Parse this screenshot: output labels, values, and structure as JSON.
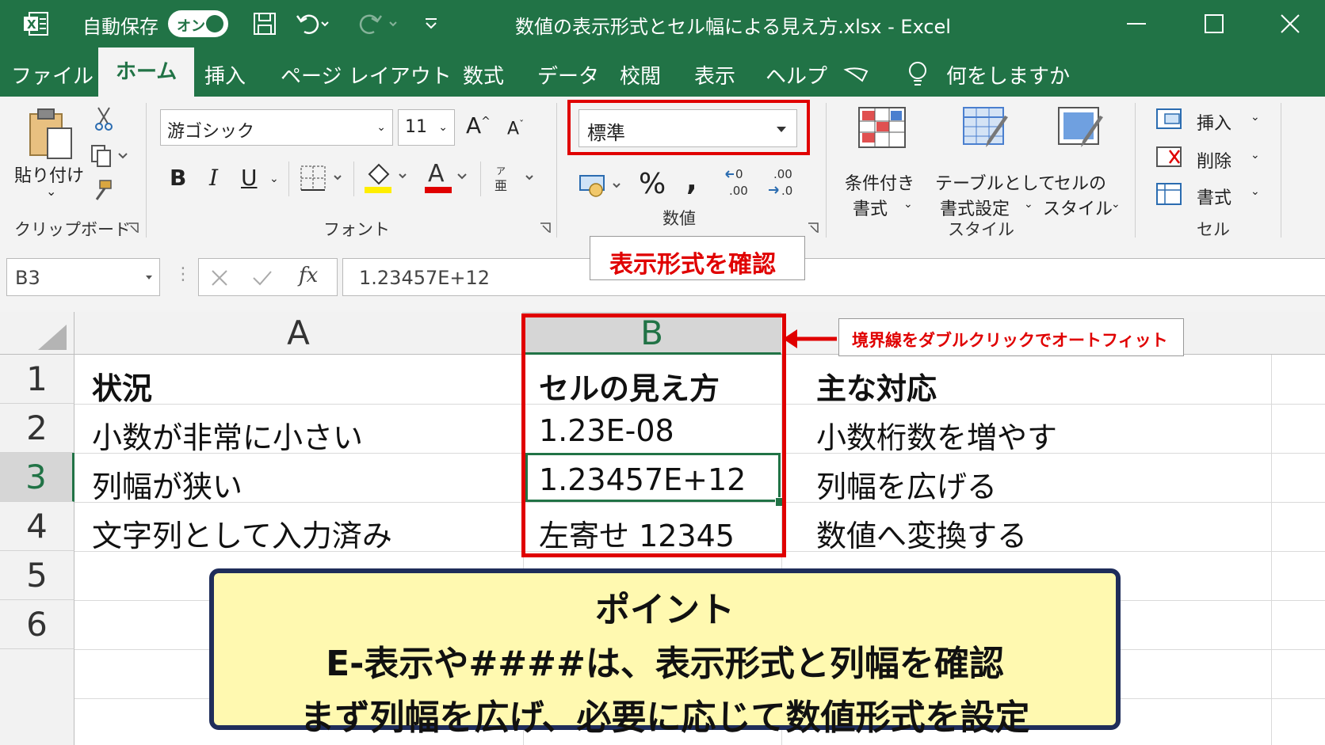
{
  "title_bar": {
    "app_icon": "excel-icon",
    "autosave_label": "自動保存",
    "autosave_state": "オン",
    "document_title": "数値の表示形式とセル幅による見え方.xlsx  -  Excel"
  },
  "menu": {
    "tabs": [
      "ファイル",
      "ホーム",
      "挿入",
      "ページ レイアウト",
      "数式",
      "データ",
      "校閲",
      "表示",
      "ヘルプ"
    ],
    "active_tab": "ホーム",
    "tell_me": "何をしますか"
  },
  "ribbon": {
    "clipboard": {
      "paste_label": "貼り付け",
      "group_label": "クリップボード"
    },
    "font": {
      "font_name": "游ゴシック",
      "font_size": "11",
      "group_label": "フォント",
      "bold": "B",
      "italic": "I",
      "underline": "U",
      "font_color": "A"
    },
    "number": {
      "format": "標準",
      "percent": "%",
      "comma": ",",
      "increase_decimal": "←0 .00",
      "decrease_decimal": ".00 →.0",
      "group_label": "数値"
    },
    "styles": {
      "conditional_line1": "条件付き",
      "conditional_line2": "書式",
      "table_line1": "テーブルとして",
      "table_line2": "書式設定",
      "cell_style_line1": "セルの",
      "cell_style_line2": "スタイル",
      "group_label": "スタイル"
    },
    "cells": {
      "insert": "挿入",
      "delete": "削除",
      "format": "書式",
      "group_label": "セル"
    }
  },
  "formula_bar": {
    "name_box": "B3",
    "value": "1.23457E+12",
    "fx": "fx"
  },
  "sheet": {
    "columns": [
      "A",
      "B"
    ],
    "rows": [
      "1",
      "2",
      "3",
      "4",
      "5",
      "6"
    ],
    "cells": {
      "A1": "状況",
      "B1": "セルの見え方",
      "C1": "主な対応",
      "A2": "小数が非常に小さい",
      "B2": "1.23E-08",
      "C2": "小数桁数を増やす",
      "A3": "列幅が狭い",
      "B3": "1.23457E+12",
      "C3": "列幅を広げる",
      "A4": "文字列として入力済み",
      "B4": "左寄せ 12345",
      "C4": "数値へ変換する"
    }
  },
  "annotations": {
    "format_callout": "表示形式を確認",
    "autofit_callout": "境界線をダブルクリックでオートフィット",
    "point_title": "ポイント",
    "point_line1": "E-表示や####は、表示形式と列幅を確認",
    "point_line2": "まず列幅を広げ、必要に応じて数値形式を設定"
  },
  "colors": {
    "excel_green": "#217346",
    "highlight_red": "#e00000",
    "note_bg": "#fff9b0",
    "note_border": "#1f2d5a"
  }
}
